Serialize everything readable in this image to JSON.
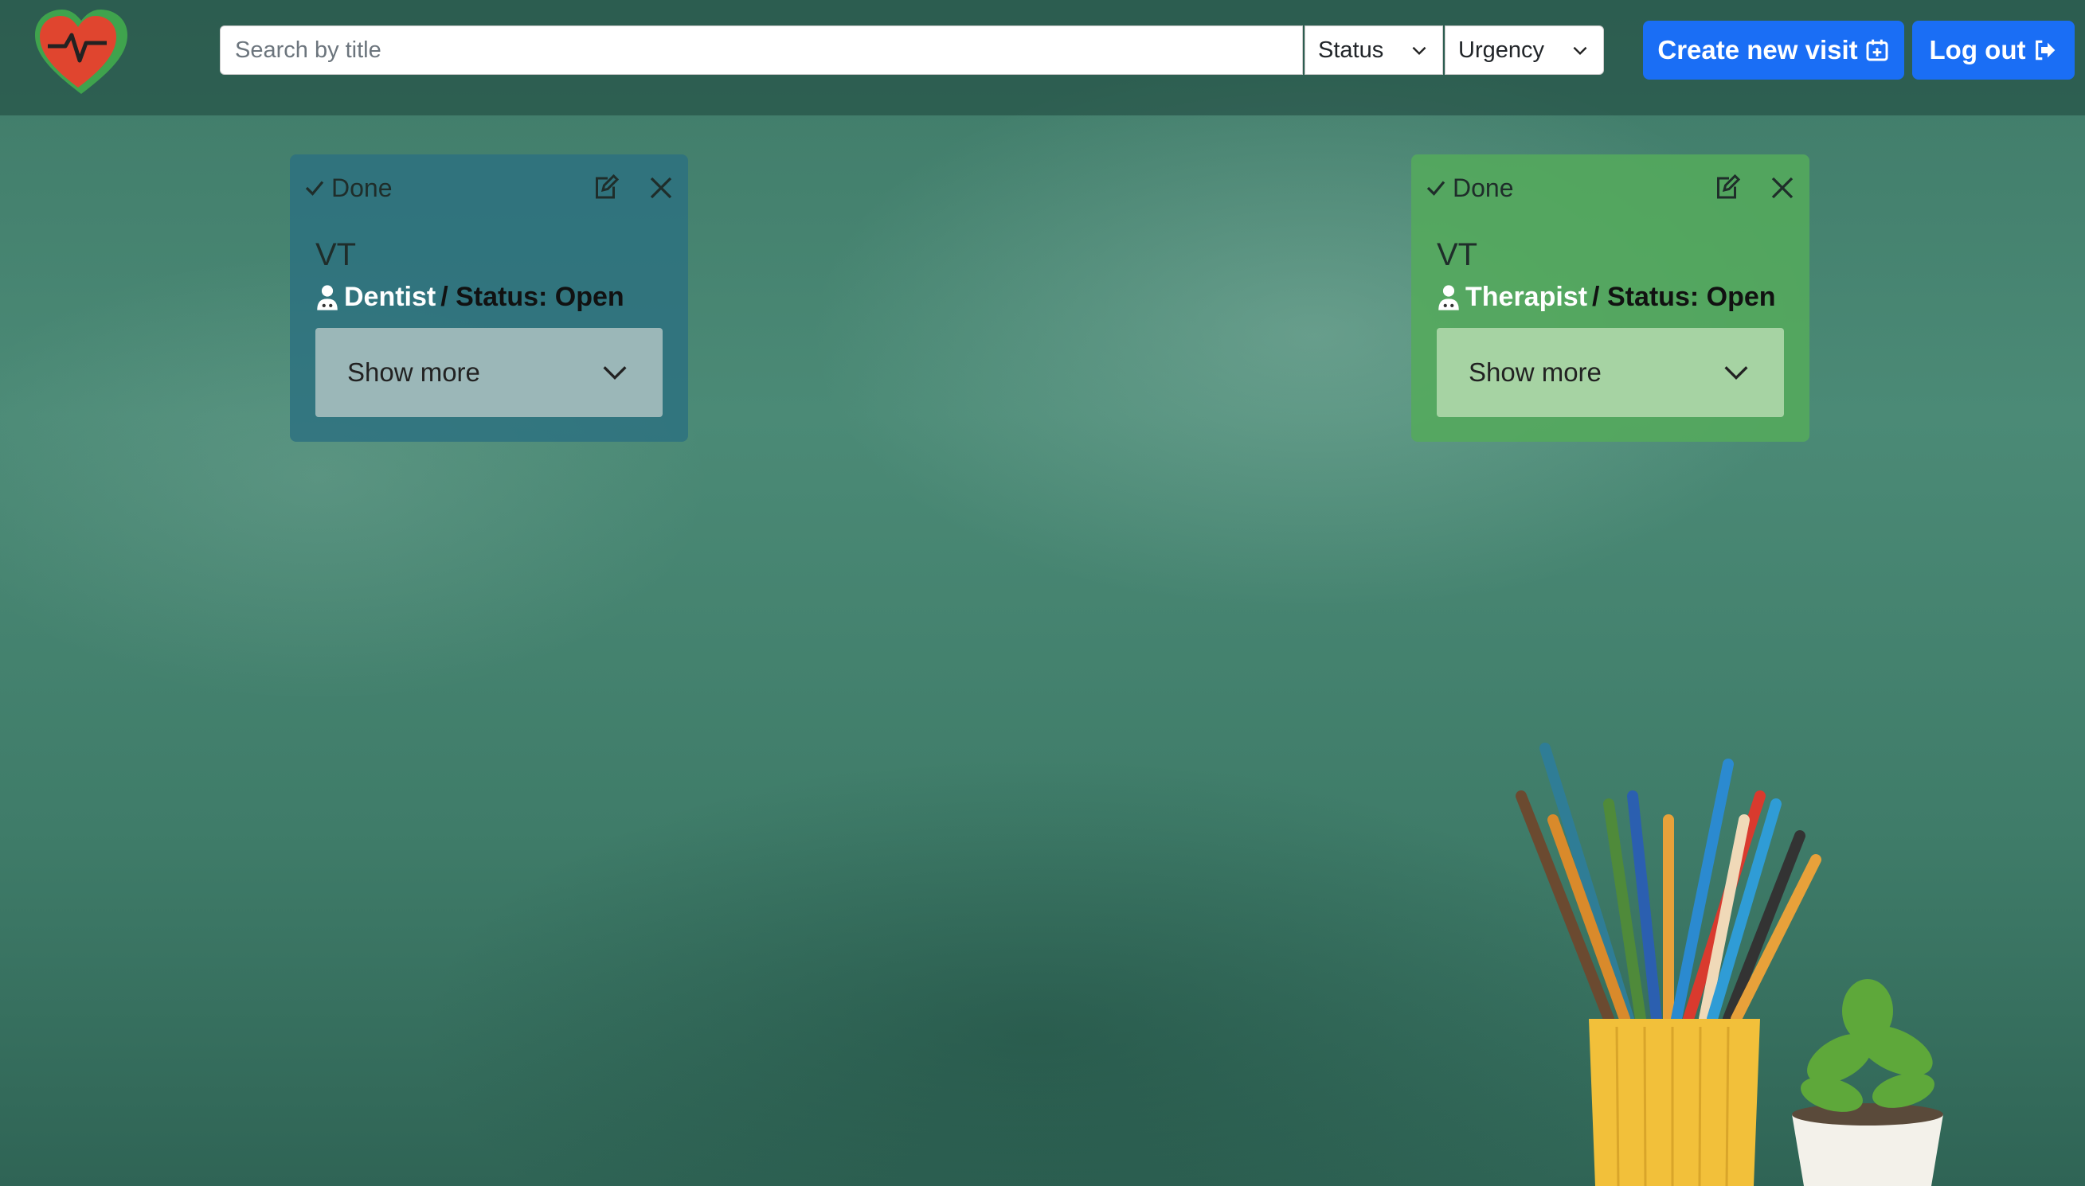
{
  "header": {
    "logo_icon": "heart-pulse-icon",
    "search_placeholder": "Search by title",
    "status_filter": "Status",
    "urgency_filter": "Urgency",
    "create_button": "Create new visit",
    "create_icon": "calendar-plus-icon",
    "logout_button": "Log out",
    "logout_icon": "sign-out-icon"
  },
  "cards": [
    {
      "done_label": "Done",
      "title": "VT",
      "specialty": "Dentist",
      "status_text": " / Status: Open",
      "show_more": "Show more",
      "color": "#2c7080"
    },
    {
      "done_label": "Done",
      "title": "VT",
      "specialty": "Therapist",
      "status_text": " / Status: Open",
      "show_more": "Show more",
      "color": "#54aa5c"
    }
  ],
  "colors": {
    "primary_button": "#1a6ef5",
    "background": "#4b8a76"
  }
}
